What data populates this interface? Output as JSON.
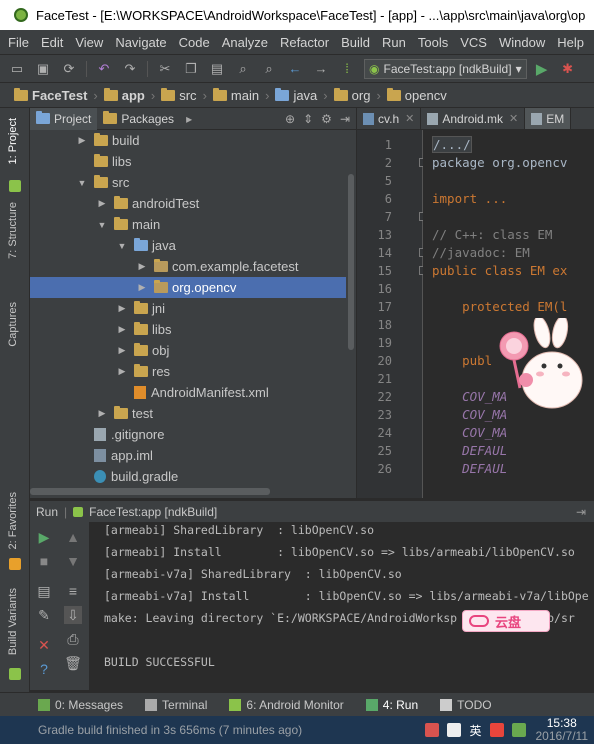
{
  "window": {
    "title": "FaceTest - [E:\\WORKSPACE\\AndroidWorkspace\\FaceTest] - [app] - ...\\app\\src\\main\\java\\org\\op"
  },
  "menu": [
    "File",
    "Edit",
    "View",
    "Navigate",
    "Code",
    "Analyze",
    "Refactor",
    "Build",
    "Run",
    "Tools",
    "VCS",
    "Window",
    "Help"
  ],
  "toolbar": {
    "run_config": "FaceTest:app [ndkBuild]"
  },
  "breadcrumb": [
    "FaceTest",
    "app",
    "src",
    "main",
    "java",
    "org",
    "opencv"
  ],
  "left_strip": {
    "project": "1: Project",
    "structure": "7: Structure",
    "captures": "Captures",
    "favorites": "2: Favorites",
    "build_variants": "Build Variants"
  },
  "project_panel": {
    "tabs": [
      "Project",
      "Packages"
    ],
    "tree": [
      {
        "label": "build",
        "type": "folder",
        "arrow": "right"
      },
      {
        "label": "libs",
        "type": "folder",
        "arrow": ""
      },
      {
        "label": "src",
        "type": "folder",
        "arrow": "down"
      },
      {
        "label": "androidTest",
        "type": "folder",
        "arrow": "right"
      },
      {
        "label": "main",
        "type": "folder",
        "arrow": "down"
      },
      {
        "label": "java",
        "type": "folder-blue",
        "arrow": "down"
      },
      {
        "label": "com.example.facetest",
        "type": "package",
        "arrow": "right"
      },
      {
        "label": "org.opencv",
        "type": "package",
        "arrow": "right",
        "selected": true
      },
      {
        "label": "jni",
        "type": "folder",
        "arrow": "right"
      },
      {
        "label": "libs",
        "type": "folder",
        "arrow": "right"
      },
      {
        "label": "obj",
        "type": "folder",
        "arrow": "right"
      },
      {
        "label": "res",
        "type": "folder",
        "arrow": "right"
      },
      {
        "label": "AndroidManifest.xml",
        "type": "xml",
        "arrow": ""
      },
      {
        "label": "test",
        "type": "folder",
        "arrow": "right"
      },
      {
        "label": ".gitignore",
        "type": "file",
        "arrow": ""
      },
      {
        "label": "app.iml",
        "type": "iml",
        "arrow": ""
      },
      {
        "label": "build.gradle",
        "type": "gradle",
        "arrow": ""
      }
    ]
  },
  "editor": {
    "tabs": [
      {
        "label": "cv.h"
      },
      {
        "label": "Android.mk"
      },
      {
        "label": "EM",
        "active": true
      }
    ],
    "line_numbers": [
      "1",
      "2",
      "5",
      "6",
      "7",
      "13",
      "14",
      "15",
      "16",
      "17",
      "18",
      "19",
      "20",
      "21",
      "22",
      "23",
      "24",
      "25",
      "26"
    ],
    "lines": [
      {
        "text": ""
      },
      {
        "text": "/.../",
        "cls": "fb"
      },
      {
        "text": "package org.opencv"
      },
      {
        "text": ""
      },
      {
        "text": "import ...",
        "cls": "kwfb"
      },
      {
        "text": ""
      },
      {
        "text": "// C++: class EM",
        "cls": "cm"
      },
      {
        "text": "//javadoc: EM",
        "cls": "cm"
      },
      {
        "text": "public class EM ex",
        "cls": "decl"
      },
      {
        "text": ""
      },
      {
        "text": "    protected EM(l",
        "cls": "kwlead"
      },
      {
        "text": ""
      },
      {
        "text": ""
      },
      {
        "text": "    publ",
        "cls": "kwlead"
      },
      {
        "text": ""
      },
      {
        "text": "    COV_MA",
        "cls": "fd"
      },
      {
        "text": "    COV_MA",
        "cls": "fd"
      },
      {
        "text": "    COV_MA",
        "cls": "fd"
      },
      {
        "text": "    DEFAUL",
        "cls": "fd"
      },
      {
        "text": "    DEFAUL",
        "cls": "fd"
      }
    ]
  },
  "run_panel": {
    "label": "Run",
    "config": "FaceTest:app [ndkBuild]",
    "console": [
      "[armeabi] SharedLibrary  : libOpenCV.so",
      "[armeabi] Install        : libOpenCV.so => libs/armeabi/libOpenCV.so",
      "[armeabi-v7a] SharedLibrary  : libOpenCV.so",
      "[armeabi-v7a] Install        : libOpenCV.so => libs/armeabi-v7a/libOpe",
      "make: Leaving directory `E:/WORKSPACE/AndroidWorksp          /app/sr",
      "",
      "BUILD SUCCESSFUL"
    ]
  },
  "overlay": {
    "cloud_label": "云盘"
  },
  "bottom_tabs": [
    {
      "label": "0: Messages"
    },
    {
      "label": "Terminal"
    },
    {
      "label": "6: Android Monitor"
    },
    {
      "label": "4: Run",
      "active": true
    },
    {
      "label": "TODO"
    }
  ],
  "status": {
    "message": "Gradle build finished in 3s 656ms (7 minutes ago)",
    "time": "15:38",
    "date": "2016/7/11",
    "ime": "英"
  },
  "colors": {
    "selection": "#4b6eaf",
    "keyword": "#cc7832",
    "comment": "#808080",
    "field": "#9876aa",
    "success": "#8bc34a"
  }
}
